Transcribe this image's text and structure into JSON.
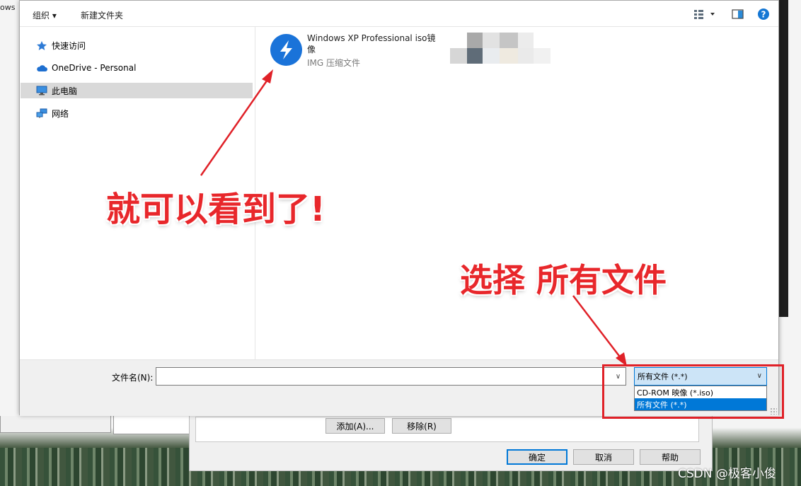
{
  "background": {
    "topleft_text": "ows",
    "add_button": "添加(A)...",
    "remove_button": "移除(R)",
    "ok_button": "确定",
    "cancel_button": "取消",
    "help_button": "帮助"
  },
  "toolbar": {
    "organize": "组织 ▾",
    "new_folder": "新建文件夹",
    "view_menu_icon": "view-options-icon",
    "preview_pane_icon": "preview-pane-icon",
    "help_icon": "help-icon"
  },
  "sidebar": {
    "items": [
      {
        "label": "快速访问",
        "icon": "star-icon"
      },
      {
        "label": "OneDrive - Personal",
        "icon": "cloud-icon"
      },
      {
        "label": "此电脑",
        "icon": "computer-icon",
        "selected": true
      },
      {
        "label": "网络",
        "icon": "network-icon"
      }
    ]
  },
  "file": {
    "name": "Windows XP Professional iso镜像",
    "type": "IMG 压缩文件",
    "icon": "bandizip-icon"
  },
  "bottom": {
    "filename_label": "文件名(N):",
    "filename_value": "",
    "filetype_selected": "所有文件 (*.*)",
    "filetype_options": [
      "CD-ROM 映像 (*.iso)",
      "所有文件 (*.*)"
    ]
  },
  "annotations": {
    "text1": "就可以看到了!",
    "text2": "选择 所有文件",
    "color": "#e8272b"
  },
  "watermark": "CSDN @极客小俊"
}
